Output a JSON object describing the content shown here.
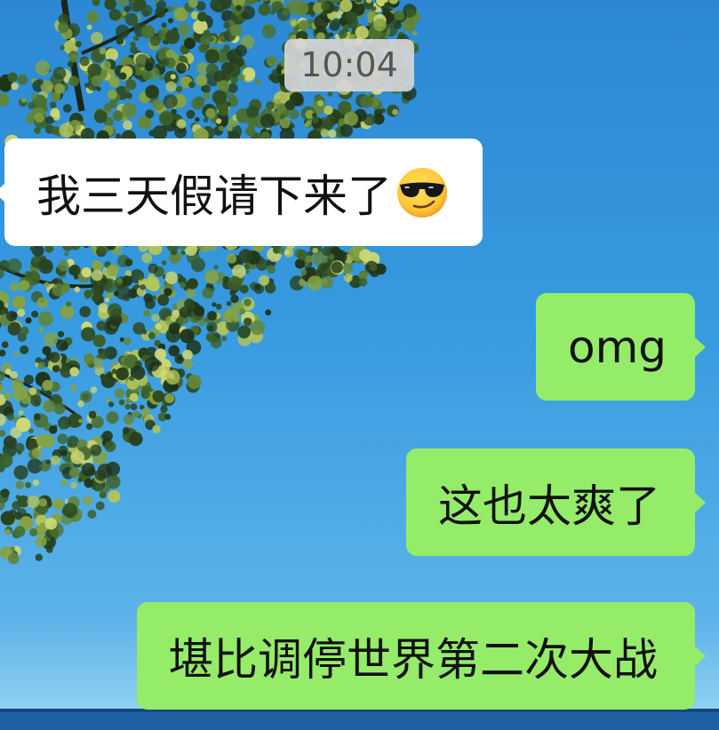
{
  "timestamp": "10:04",
  "messages": [
    {
      "direction": "incoming",
      "text": "我三天假请下来了",
      "emoji": "smiling-face-with-sunglasses-icon"
    },
    {
      "direction": "outgoing",
      "text": "omg"
    },
    {
      "direction": "outgoing",
      "text": "这也太爽了"
    },
    {
      "direction": "outgoing",
      "text": "堪比调停世界第二次大战"
    }
  ],
  "colors": {
    "incoming_bubble": "#FFFFFF",
    "outgoing_bubble": "#95EC69",
    "message_text": "#111111",
    "timestamp_text": "#555555"
  }
}
